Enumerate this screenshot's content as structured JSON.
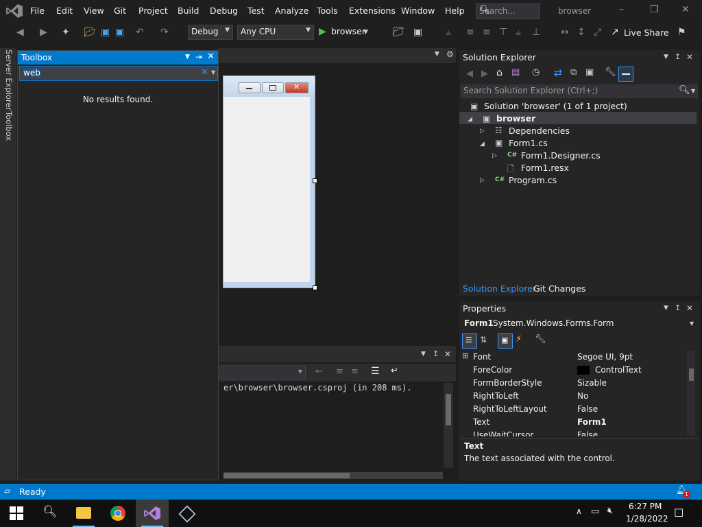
{
  "menubar": {
    "items": [
      "File",
      "Edit",
      "View",
      "Git",
      "Project",
      "Build",
      "Debug",
      "Test",
      "Analyze",
      "Tools",
      "Extensions",
      "Window",
      "Help"
    ],
    "search_placeholder": "Search...",
    "window_title": "browser"
  },
  "toolbar": {
    "config": "Debug",
    "platform": "Any CPU",
    "run_target": "browser",
    "live_share": "Live Share"
  },
  "left_strip": {
    "server_explorer": "Server Explorer",
    "toolbox": "Toolbox"
  },
  "toolbox": {
    "title": "Toolbox",
    "search_value": "web",
    "no_results": "No results found."
  },
  "output": {
    "text": "er\\browser\\browser.csproj (in 208 ms)."
  },
  "solution_explorer": {
    "title": "Solution Explorer",
    "search_placeholder": "Search Solution Explorer (Ctrl+;)",
    "solution": "Solution 'browser' (1 of 1 project)",
    "project": "browser",
    "items": [
      "Dependencies",
      "Form1.cs",
      "Form1.Designer.cs",
      "Form1.resx",
      "Program.cs"
    ],
    "tabs": [
      "Solution Explorer",
      "Git Changes"
    ]
  },
  "properties": {
    "title": "Properties",
    "object_name": "Form1",
    "object_type": "System.Windows.Forms.Form",
    "rows": [
      {
        "name": "Font",
        "value": "Segoe UI, 9pt"
      },
      {
        "name": "ForeColor",
        "value": "ControlText"
      },
      {
        "name": "FormBorderStyle",
        "value": "Sizable"
      },
      {
        "name": "RightToLeft",
        "value": "No"
      },
      {
        "name": "RightToLeftLayout",
        "value": "False"
      },
      {
        "name": "Text",
        "value": "Form1"
      },
      {
        "name": "UseWaitCursor",
        "value": "False"
      }
    ],
    "desc_title": "Text",
    "desc_text": "The text associated with the control."
  },
  "status": {
    "text": "Ready",
    "notification_count": "1"
  },
  "taskbar": {
    "time": "6:27 PM",
    "date": "1/28/2022"
  },
  "colors": {
    "accent": "#007acc",
    "background": "#1e1e1e",
    "panel": "#252526"
  }
}
